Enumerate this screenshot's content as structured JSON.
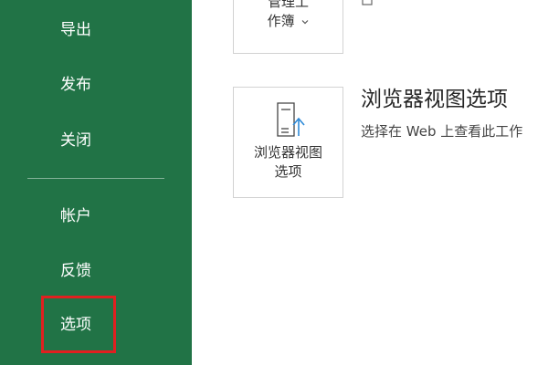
{
  "sidebar": {
    "items": [
      {
        "label": "导出"
      },
      {
        "label": "发布"
      },
      {
        "label": "关闭"
      },
      {
        "label": "帐户"
      },
      {
        "label": "反馈"
      },
      {
        "label": "选项"
      }
    ]
  },
  "main": {
    "manage_workbook": {
      "label_line1": "管理工",
      "label_line2": "作簿",
      "dropdown_icon": "chevron-down-icon"
    },
    "browser_view": {
      "tile_line1": "浏览器视图",
      "tile_line2": "选项",
      "title": "浏览器视图选项",
      "description": "选择在 Web 上查看此工作",
      "icon": "browser-view-icon"
    }
  },
  "colors": {
    "sidebar_bg": "#217346",
    "highlight_border": "#e02020",
    "accent_blue": "#2e8ad8"
  }
}
